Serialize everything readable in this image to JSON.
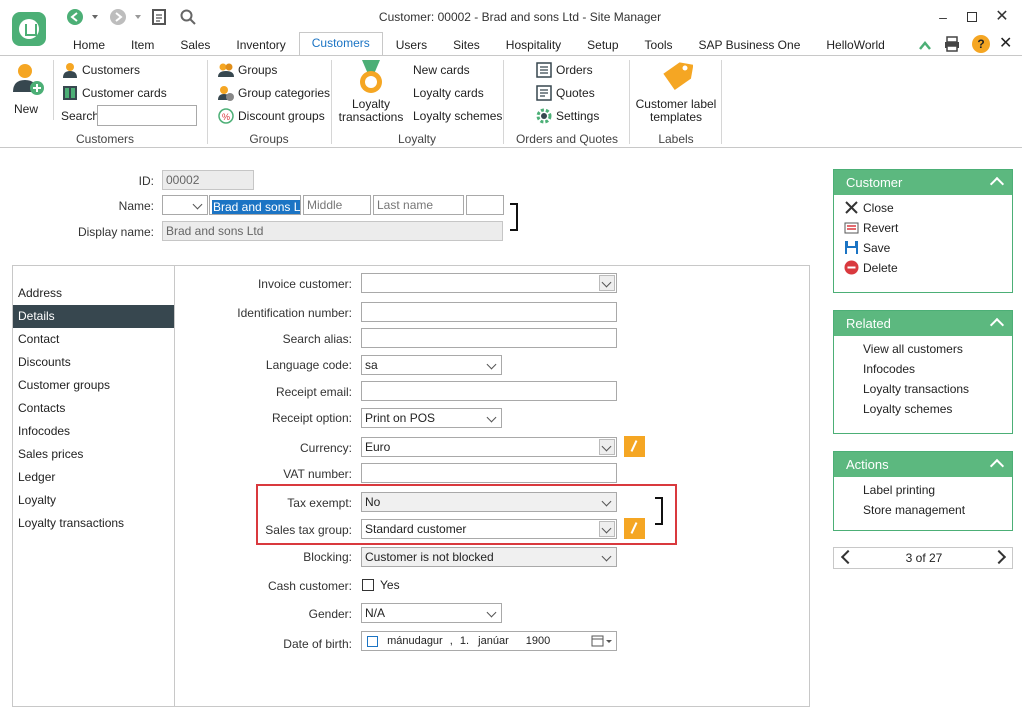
{
  "window": {
    "title": "Customer: 00002 - Brad and sons Ltd - Site Manager"
  },
  "menu_tabs": [
    {
      "label": "Home"
    },
    {
      "label": "Item"
    },
    {
      "label": "Sales"
    },
    {
      "label": "Inventory"
    },
    {
      "label": "Customers"
    },
    {
      "label": "Users"
    },
    {
      "label": "Sites"
    },
    {
      "label": "Hospitality"
    },
    {
      "label": "Setup"
    },
    {
      "label": "Tools"
    },
    {
      "label": "SAP Business One"
    },
    {
      "label": "HelloWorld"
    }
  ],
  "active_tab": "Customers",
  "ribbon": {
    "new_label": "New",
    "customers_group": {
      "caption": "Customers",
      "customers": "Customers",
      "customer_cards": "Customer cards",
      "search_label": "Search",
      "search_value": ""
    },
    "groups_group": {
      "caption": "Groups",
      "groups": "Groups",
      "group_categories": "Group categories",
      "discount_groups": "Discount groups"
    },
    "loyalty_group": {
      "caption": "Loyalty",
      "loyalty_transactions": "Loyalty transactions",
      "new_cards": "New cards",
      "loyalty_cards": "Loyalty cards",
      "loyalty_schemes": "Loyalty schemes"
    },
    "orders_group": {
      "caption": "Orders and Quotes",
      "orders": "Orders",
      "quotes": "Quotes",
      "settings": "Settings"
    },
    "labels_group": {
      "caption": "Labels",
      "customer_label_templates": "Customer label templates"
    }
  },
  "header_form": {
    "id_label": "ID:",
    "id_value": "00002",
    "name_label": "Name:",
    "name_title": "",
    "name_first": "Brad and sons Ltd",
    "name_middle_placeholder": "Middle",
    "name_last_placeholder": "Last name",
    "name_suffix": "",
    "display_name_label": "Display name:",
    "display_name_value": "Brad and sons Ltd"
  },
  "left_nav": [
    {
      "label": "Address"
    },
    {
      "label": "Details"
    },
    {
      "label": "Contact"
    },
    {
      "label": "Discounts"
    },
    {
      "label": "Customer groups"
    },
    {
      "label": "Contacts"
    },
    {
      "label": "Infocodes"
    },
    {
      "label": "Sales prices"
    },
    {
      "label": "Ledger"
    },
    {
      "label": "Loyalty"
    },
    {
      "label": "Loyalty transactions"
    }
  ],
  "active_nav": "Details",
  "details": {
    "invoice_customer": {
      "label": "Invoice customer:",
      "value": ""
    },
    "identification_number": {
      "label": "Identification number:",
      "value": ""
    },
    "search_alias": {
      "label": "Search alias:",
      "value": ""
    },
    "language_code": {
      "label": "Language code:",
      "value": "sa"
    },
    "receipt_email": {
      "label": "Receipt email:",
      "value": ""
    },
    "receipt_option": {
      "label": "Receipt option:",
      "value": "Print on POS"
    },
    "currency": {
      "label": "Currency:",
      "value": "Euro"
    },
    "vat_number": {
      "label": "VAT number:",
      "value": ""
    },
    "tax_exempt": {
      "label": "Tax exempt:",
      "value": "No"
    },
    "sales_tax_group": {
      "label": "Sales tax group:",
      "value": "Standard customer"
    },
    "blocking": {
      "label": "Blocking:",
      "value": "Customer is not blocked"
    },
    "cash_customer": {
      "label": "Cash customer:",
      "checkbox_label": "Yes",
      "checked": false
    },
    "gender": {
      "label": "Gender:",
      "value": "N/A"
    },
    "date_of_birth": {
      "label": "Date of birth:",
      "day_name": "mánudagur",
      "sep": ",",
      "day": "1.",
      "month": "janúar",
      "year": "1900"
    }
  },
  "customer_panel": {
    "title": "Customer",
    "close": "Close",
    "revert": "Revert",
    "save": "Save",
    "delete": "Delete"
  },
  "related_panel": {
    "title": "Related",
    "items": [
      "View all customers",
      "Infocodes",
      "Loyalty transactions",
      "Loyalty schemes"
    ]
  },
  "actions_panel": {
    "title": "Actions",
    "items": [
      "Label printing",
      "Store management"
    ]
  },
  "pager": {
    "text": "3 of 27"
  },
  "colors": {
    "accent_green": "#5cb87f",
    "active_tab_blue": "#1b74c4",
    "nav_active": "#37474f",
    "edit_orange": "#f5a623",
    "highlight_red": "#d9393e"
  }
}
